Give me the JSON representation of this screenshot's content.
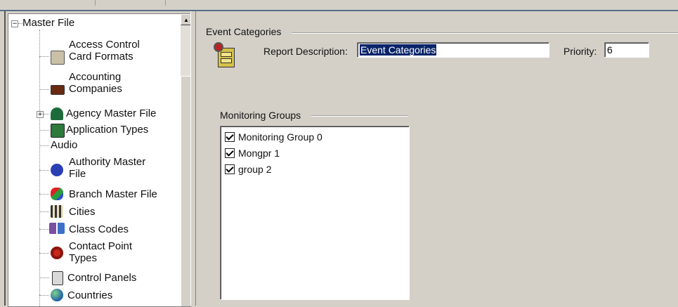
{
  "tree": {
    "root_label": "Master File",
    "items": [
      {
        "label": "Access Control Card Formats",
        "line1": "Access Control",
        "line2": "Card Formats",
        "icon": "card-formats-icon",
        "expandable": false
      },
      {
        "label": "Accounting Companies",
        "line1": "Accounting",
        "line2": "Companies",
        "icon": "accounting-icon",
        "expandable": false
      },
      {
        "label": "Agency Master File",
        "line1": "Agency Master File",
        "line2": "",
        "icon": "agency-icon",
        "expandable": true
      },
      {
        "label": "Application Types",
        "line1": "Application Types",
        "line2": "",
        "icon": "application-types-icon",
        "expandable": false
      },
      {
        "label": "Audio",
        "line1": "Audio",
        "line2": "",
        "icon": "",
        "expandable": false
      },
      {
        "label": "Authority Master File",
        "line1": "Authority Master",
        "line2": "File",
        "icon": "authority-icon",
        "expandable": false
      },
      {
        "label": "Branch Master File",
        "line1": "Branch Master File",
        "line2": "",
        "icon": "branch-icon",
        "expandable": false
      },
      {
        "label": "Cities",
        "line1": "Cities",
        "line2": "",
        "icon": "cities-icon",
        "expandable": false
      },
      {
        "label": "Class Codes",
        "line1": "Class Codes",
        "line2": "",
        "icon": "class-codes-icon",
        "expandable": false
      },
      {
        "label": "Contact Point Types",
        "line1": "Contact Point",
        "line2": "Types",
        "icon": "contact-point-icon",
        "expandable": false
      },
      {
        "label": "Control Panels",
        "line1": "Control Panels",
        "line2": "",
        "icon": "control-panels-icon",
        "expandable": false
      },
      {
        "label": "Countries",
        "line1": "Countries",
        "line2": "",
        "icon": "globe-icon",
        "expandable": false
      }
    ]
  },
  "form": {
    "group_title": "Event Categories",
    "report_description_label": "Report Description:",
    "report_description_value": "Event Categories",
    "priority_label": "Priority:",
    "priority_value": "6"
  },
  "monitoring": {
    "title": "Monitoring Groups",
    "items": [
      {
        "label": "Monitoring Group 0",
        "checked": true
      },
      {
        "label": "Mongpr 1",
        "checked": true
      },
      {
        "label": "group 2",
        "checked": true
      }
    ]
  }
}
